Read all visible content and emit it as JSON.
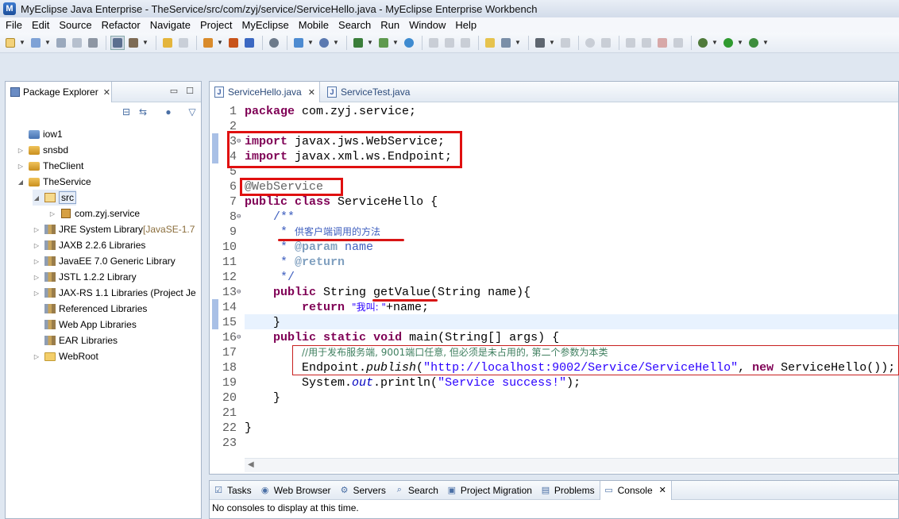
{
  "window": {
    "title": "MyEclipse Java Enterprise - TheService/src/com/zyj/service/ServiceHello.java - MyEclipse Enterprise Workbench"
  },
  "menu": [
    "File",
    "Edit",
    "Source",
    "Refactor",
    "Navigate",
    "Project",
    "MyEclipse",
    "Mobile",
    "Search",
    "Run",
    "Window",
    "Help"
  ],
  "package_explorer": {
    "tab_label": "Package Explorer",
    "close": "✕",
    "tree": [
      {
        "label": "iow1",
        "decoration": "",
        "icon": "project-icon",
        "twisty": ""
      },
      {
        "label": "snsbd",
        "decoration": "",
        "icon": "java-project-icon",
        "twisty": "▷"
      },
      {
        "label": "TheClient",
        "decoration": "",
        "icon": "java-project-icon",
        "twisty": "▷"
      },
      {
        "label": "TheService",
        "decoration": "",
        "icon": "java-project-icon",
        "twisty": "◢"
      },
      {
        "label": "src",
        "decoration": "",
        "icon": "source-folder-icon",
        "twisty": "◢"
      },
      {
        "label": "com.zyj.service",
        "decoration": "",
        "icon": "package-icon",
        "twisty": "▷"
      },
      {
        "label": "JRE System Library ",
        "decoration": "[JavaSE-1.7",
        "icon": "library-icon",
        "twisty": "▷"
      },
      {
        "label": "JAXB 2.2.6 Libraries",
        "decoration": "",
        "icon": "library-icon",
        "twisty": "▷"
      },
      {
        "label": "JavaEE 7.0 Generic Library",
        "decoration": "",
        "icon": "library-icon",
        "twisty": "▷"
      },
      {
        "label": "JSTL 1.2.2 Library",
        "decoration": "",
        "icon": "library-icon",
        "twisty": "▷"
      },
      {
        "label": "JAX-RS 1.1 Libraries (Project Je",
        "decoration": "",
        "icon": "library-icon",
        "twisty": "▷"
      },
      {
        "label": "Referenced Libraries",
        "decoration": "",
        "icon": "library-icon",
        "twisty": ""
      },
      {
        "label": "Web App Libraries",
        "decoration": "",
        "icon": "library-icon",
        "twisty": ""
      },
      {
        "label": "EAR Libraries",
        "decoration": "",
        "icon": "library-icon",
        "twisty": ""
      },
      {
        "label": "WebRoot",
        "decoration": "",
        "icon": "folder-icon",
        "twisty": "▷"
      }
    ]
  },
  "editor": {
    "tabs": [
      {
        "label": "ServiceHello.java",
        "close": "✕"
      },
      {
        "label": "ServiceTest.java"
      }
    ],
    "lines": [
      {
        "n": "1",
        "tokens": [
          {
            "t": "package",
            "c": "kw"
          },
          {
            "t": " com.zyj.service;",
            "c": ""
          }
        ]
      },
      {
        "n": "2",
        "tokens": []
      },
      {
        "n": "3",
        "fold": "⊖",
        "tokens": [
          {
            "t": "import",
            "c": "kw"
          },
          {
            "t": " javax.jws.WebService;",
            "c": ""
          }
        ]
      },
      {
        "n": "4",
        "tokens": [
          {
            "t": "import",
            "c": "kw"
          },
          {
            "t": " javax.xml.ws.Endpoint;",
            "c": ""
          }
        ]
      },
      {
        "n": "5",
        "tokens": []
      },
      {
        "n": "6",
        "tokens": [
          {
            "t": "@WebService",
            "c": "ann"
          }
        ]
      },
      {
        "n": "7",
        "tokens": [
          {
            "t": "public",
            "c": "kw"
          },
          {
            "t": " ",
            "c": ""
          },
          {
            "t": "class",
            "c": "kw"
          },
          {
            "t": " ServiceHello {",
            "c": ""
          }
        ]
      },
      {
        "n": "8",
        "fold": "⊖",
        "tokens": [
          {
            "t": "    /**",
            "c": "jdoc"
          }
        ]
      },
      {
        "n": "9",
        "tokens": [
          {
            "t": "     * ",
            "c": "jdoc"
          },
          {
            "t": "供客户端调用的方法",
            "c": "jdoc cjk"
          }
        ]
      },
      {
        "n": "10",
        "tokens": [
          {
            "t": "     * ",
            "c": "jdoc"
          },
          {
            "t": "@param",
            "c": "jtag"
          },
          {
            "t": " name",
            "c": "jdoc"
          }
        ]
      },
      {
        "n": "11",
        "tokens": [
          {
            "t": "     * ",
            "c": "jdoc"
          },
          {
            "t": "@return",
            "c": "jtag"
          }
        ]
      },
      {
        "n": "12",
        "tokens": [
          {
            "t": "     */",
            "c": "jdoc"
          }
        ]
      },
      {
        "n": "13",
        "fold": "⊖",
        "tokens": [
          {
            "t": "    ",
            "c": ""
          },
          {
            "t": "public",
            "c": "kw"
          },
          {
            "t": " String getValue(String name){",
            "c": ""
          }
        ]
      },
      {
        "n": "14",
        "tokens": [
          {
            "t": "        ",
            "c": ""
          },
          {
            "t": "return",
            "c": "kw"
          },
          {
            "t": " ",
            "c": ""
          },
          {
            "t": "\"我叫: \"",
            "c": "str cjk"
          },
          {
            "t": "+name;",
            "c": ""
          }
        ]
      },
      {
        "n": "15",
        "tokens": [
          {
            "t": "    }",
            "c": ""
          }
        ]
      },
      {
        "n": "16",
        "fold": "⊖",
        "tokens": [
          {
            "t": "    ",
            "c": ""
          },
          {
            "t": "public",
            "c": "kw"
          },
          {
            "t": " ",
            "c": ""
          },
          {
            "t": "static",
            "c": "kw"
          },
          {
            "t": " ",
            "c": ""
          },
          {
            "t": "void",
            "c": "kw"
          },
          {
            "t": " main(String[] args) {",
            "c": ""
          }
        ]
      },
      {
        "n": "17",
        "tokens": [
          {
            "t": "        ",
            "c": ""
          },
          {
            "t": "//用于发布服务端, 9001端口任意, 但必须是未占用的, 第二个参数为本类",
            "c": "cmt"
          }
        ]
      },
      {
        "n": "18",
        "tokens": [
          {
            "t": "        Endpoint.",
            "c": ""
          },
          {
            "t": "publish",
            "c": "it"
          },
          {
            "t": "(",
            "c": ""
          },
          {
            "t": "\"http://localhost:9002/Service/ServiceHello\"",
            "c": "str"
          },
          {
            "t": ", ",
            "c": ""
          },
          {
            "t": "new",
            "c": "kw"
          },
          {
            "t": " ServiceHello());",
            "c": ""
          }
        ]
      },
      {
        "n": "19",
        "tokens": [
          {
            "t": "        System.",
            "c": ""
          },
          {
            "t": "out",
            "c": "fld"
          },
          {
            "t": ".println(",
            "c": ""
          },
          {
            "t": "\"Service success!\"",
            "c": "str"
          },
          {
            "t": ");",
            "c": ""
          }
        ]
      },
      {
        "n": "20",
        "tokens": [
          {
            "t": "    }",
            "c": ""
          }
        ]
      },
      {
        "n": "21",
        "tokens": []
      },
      {
        "n": "22",
        "tokens": [
          {
            "t": "}",
            "c": ""
          }
        ]
      },
      {
        "n": "23",
        "tokens": []
      }
    ]
  },
  "bottom_panel": {
    "tabs": [
      {
        "label": "Tasks",
        "icon": "tasks-icon"
      },
      {
        "label": "Web Browser",
        "icon": "globe-icon"
      },
      {
        "label": "Servers",
        "icon": "servers-icon"
      },
      {
        "label": "Search",
        "icon": "search-icon"
      },
      {
        "label": "Project Migration",
        "icon": "migration-icon"
      },
      {
        "label": "Problems",
        "icon": "problems-icon"
      },
      {
        "label": "Console",
        "icon": "console-icon",
        "active": true,
        "close": "✕"
      }
    ],
    "console_text": "No consoles to display at this time."
  },
  "colors": {
    "keyword": "#7f0055",
    "string": "#2a00ff",
    "comment": "#3f7f5f",
    "javadoc": "#3f5fbf",
    "annotation_box": "#e01010"
  }
}
